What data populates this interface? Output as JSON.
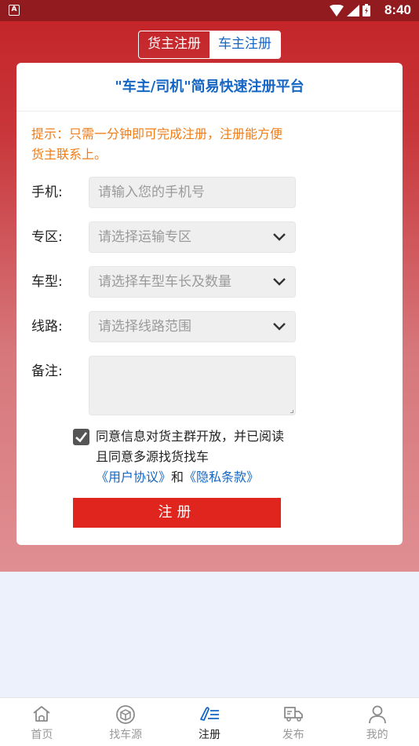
{
  "status_bar": {
    "time": "8:40",
    "app_icon_letter": "A"
  },
  "segments": [
    {
      "label": "货主注册",
      "active": false
    },
    {
      "label": "车主注册",
      "active": true
    }
  ],
  "card": {
    "title": "\"车主/司机\"简易快速注册平台",
    "tip": "提示：只需一分钟即可完成注册，注册能方便货主联系上。"
  },
  "form": {
    "phone": {
      "label": "手机:",
      "placeholder": "请输入您的手机号"
    },
    "zone": {
      "label": "专区:",
      "placeholder": "请选择运输专区"
    },
    "vehicle": {
      "label": "车型:",
      "placeholder": "请选择车型车长及数量"
    },
    "route": {
      "label": "线路:",
      "placeholder": "请选择线路范围"
    },
    "remark": {
      "label": "备注:"
    }
  },
  "agreement": {
    "checked": true,
    "text": "同意信息对货主群开放，并已阅读且同意多源找货找车",
    "link_user": "《用户协议》",
    "and": "和",
    "link_privacy": "《隐私条款》"
  },
  "submit_label": "注册",
  "tabbar": [
    {
      "label": "首页",
      "icon": "home-icon",
      "active": false
    },
    {
      "label": "找车源",
      "icon": "box-icon",
      "active": false
    },
    {
      "label": "注册",
      "icon": "edit-list-icon",
      "active": true
    },
    {
      "label": "发布",
      "icon": "truck-icon",
      "active": false
    },
    {
      "label": "我的",
      "icon": "user-icon",
      "active": false
    }
  ],
  "colors": {
    "brand_red": "#c4262a",
    "accent_blue": "#1566c4",
    "tip_orange": "#ef7d17",
    "button_red": "#e0251e"
  }
}
